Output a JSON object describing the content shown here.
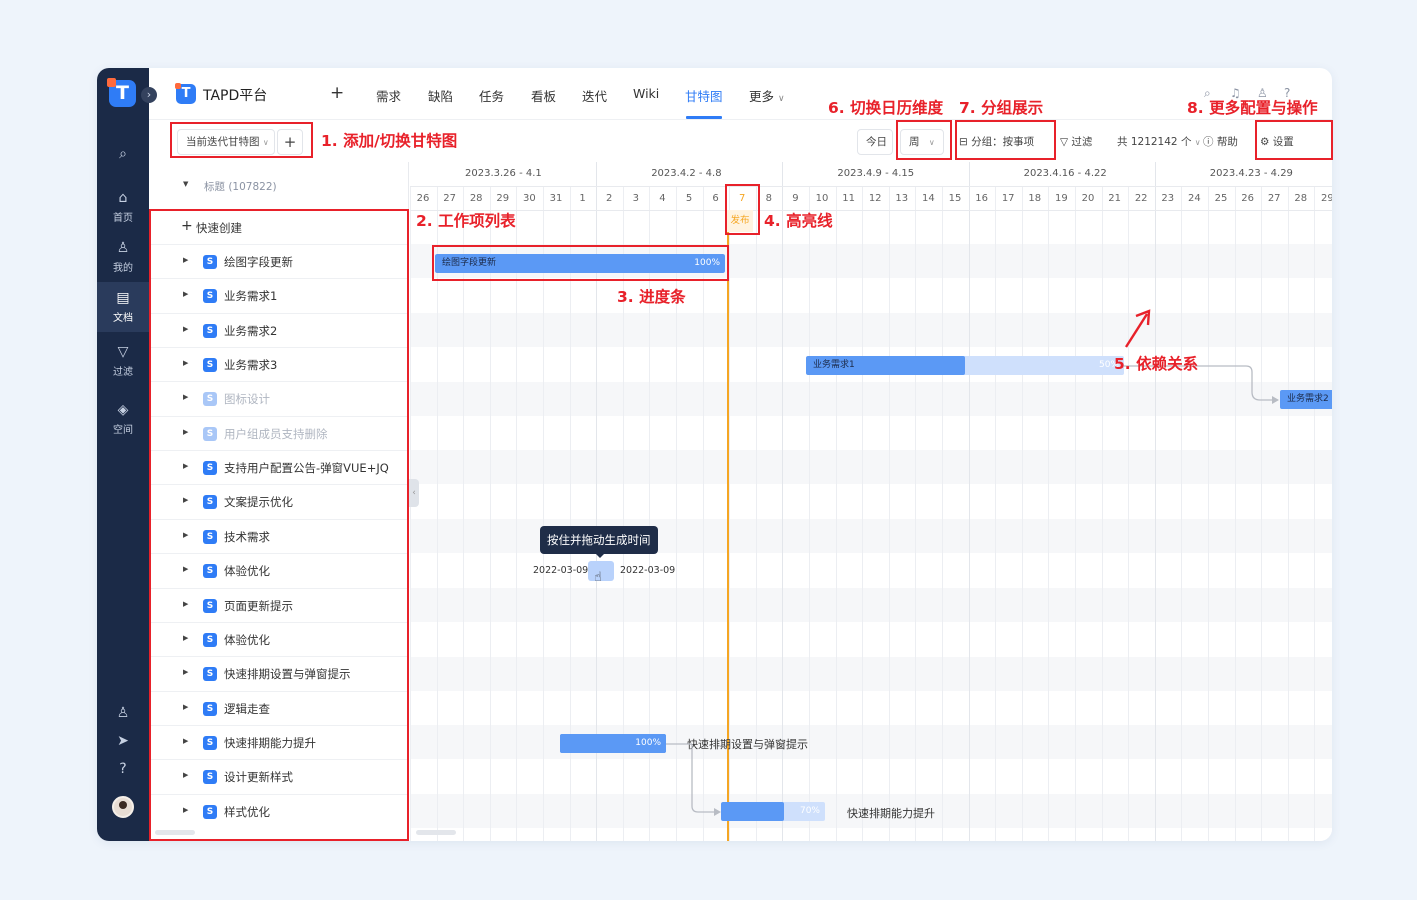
{
  "brand": {
    "name": "TAPD平台"
  },
  "nav": [
    {
      "label": "需求"
    },
    {
      "label": "缺陷"
    },
    {
      "label": "任务"
    },
    {
      "label": "看板"
    },
    {
      "label": "迭代"
    },
    {
      "label": "Wiki"
    },
    {
      "label": "甘特图",
      "active": true
    },
    {
      "label": "更多"
    }
  ],
  "sidebar": {
    "items": [
      {
        "label": "首页",
        "icon": "home-icon"
      },
      {
        "label": "我的",
        "icon": "user-icon"
      },
      {
        "label": "文档",
        "icon": "document-icon",
        "active": true
      },
      {
        "label": "过滤",
        "icon": "filter-icon"
      },
      {
        "label": "空间",
        "icon": "layers-icon"
      }
    ]
  },
  "toolbar": {
    "gantt_select": "当前迭代甘特图",
    "today": "今日",
    "period": "周",
    "group": "分组：按事项",
    "filter": "过滤",
    "total": "共 1212142 个",
    "help": "帮助",
    "settings": "设置"
  },
  "list": {
    "header": "标题 (107822)",
    "quick_create": "快速创建",
    "items": [
      {
        "label": "绘图字段更新"
      },
      {
        "label": "业务需求1"
      },
      {
        "label": "业务需求2"
      },
      {
        "label": "业务需求3"
      },
      {
        "label": "图标设计",
        "dim": true
      },
      {
        "label": "用户组成员支持删除",
        "dim": true
      },
      {
        "label": "支持用户配置公告-弹窗VUE+JQ"
      },
      {
        "label": "文案提示优化"
      },
      {
        "label": "技术需求"
      },
      {
        "label": "体验优化"
      },
      {
        "label": "页面更新提示"
      },
      {
        "label": "体验优化"
      },
      {
        "label": "快速排期设置与弹窗提示"
      },
      {
        "label": "逻辑走查"
      },
      {
        "label": "快速排期能力提升"
      },
      {
        "label": "设计更新样式"
      },
      {
        "label": "样式优化"
      }
    ]
  },
  "gantt": {
    "weeks": [
      "2023.3.26 - 4.1",
      "2023.4.2 - 4.8",
      "2023.4.9 - 4.15",
      "2023.4.16 - 4.22",
      "2023.4.23 - 4.29"
    ],
    "days": [
      "26",
      "27",
      "28",
      "29",
      "30",
      "31",
      "1",
      "2",
      "3",
      "4",
      "5",
      "6",
      "7",
      "8",
      "9",
      "10",
      "11",
      "12",
      "13",
      "14",
      "15",
      "16",
      "17",
      "18",
      "19",
      "20",
      "21",
      "22",
      "23",
      "24",
      "25",
      "26",
      "27",
      "28",
      "29"
    ],
    "highlight_label": "发布",
    "bars": [
      {
        "label": "绘图字段更新",
        "progress": "100%"
      },
      {
        "label": "业务需求1",
        "progress": "50%"
      },
      {
        "label": "业务需求2",
        "progress": ""
      },
      {
        "label": "",
        "progress": "100%"
      },
      {
        "label": "",
        "progress": "70%"
      }
    ],
    "trailing_labels": [
      "快速排期设置与弹窗提示",
      "快速排期能力提升"
    ],
    "tooltip": "按住并拖动生成时间",
    "drag_start": "2022-03-09",
    "drag_end": "2022-03-09"
  },
  "annotations": [
    "1. 添加/切换甘特图",
    "2. 工作项列表",
    "3. 进度条",
    "4. 高亮线",
    "5. 依赖关系",
    "6. 切换日历维度",
    "7. 分组展示",
    "8. 更多配置与操作"
  ],
  "colors": {
    "accent": "#2f7cf6",
    "highlight": "#f5a623",
    "annotation": "#e8212a"
  }
}
